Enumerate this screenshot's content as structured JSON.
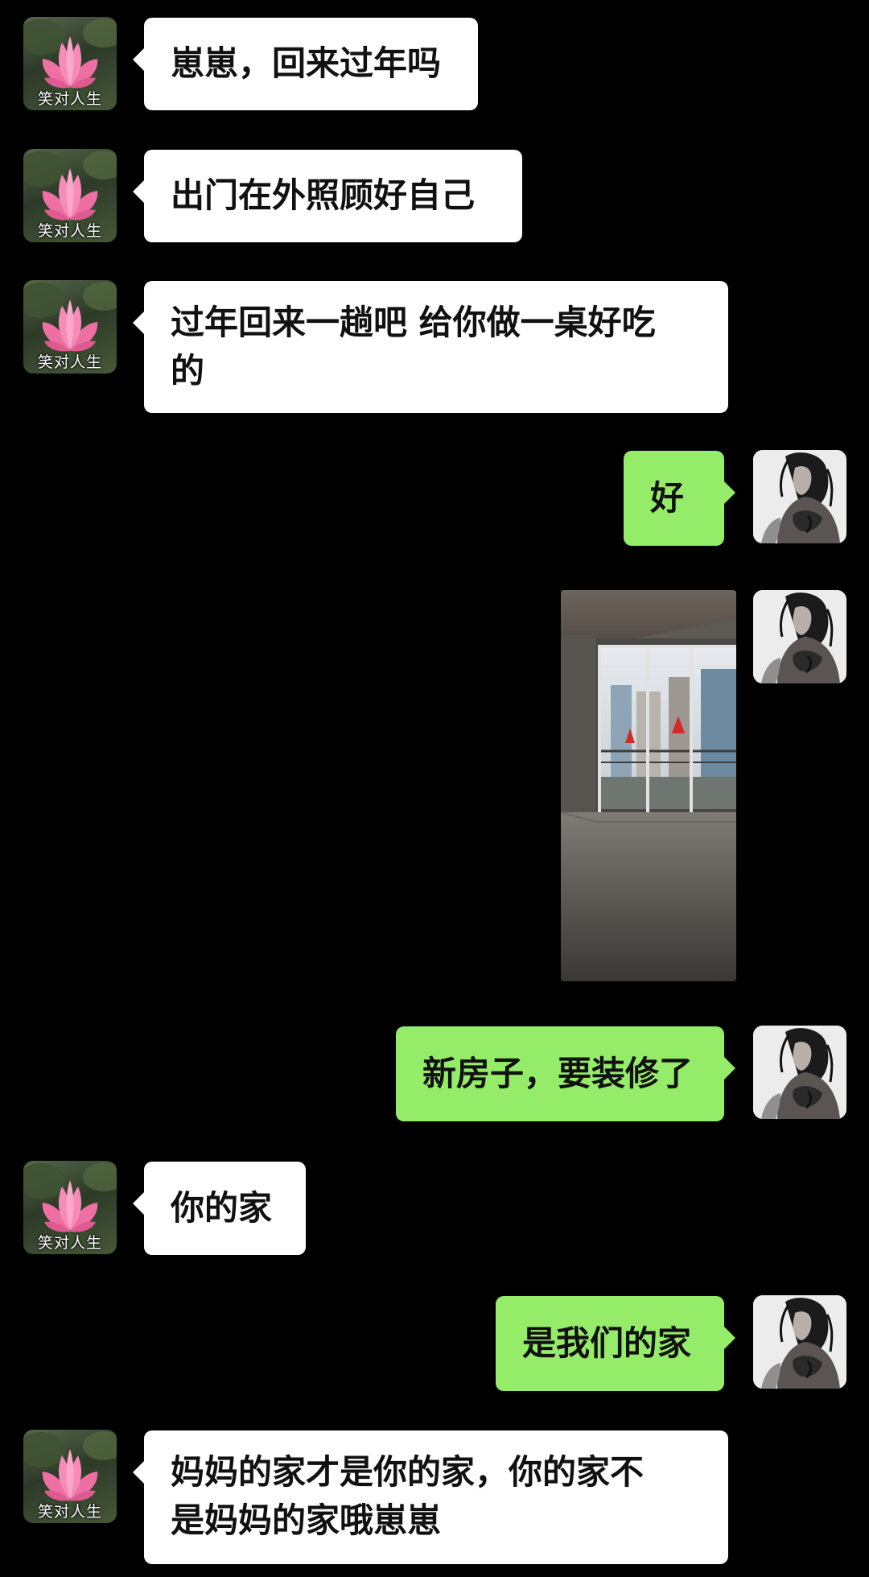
{
  "chat": {
    "contact_name": "笑对人生",
    "messages": [
      {
        "sender": "contact",
        "type": "text",
        "text": "崽崽，回来过年吗"
      },
      {
        "sender": "contact",
        "type": "text",
        "text": "出门在外照顾好自己"
      },
      {
        "sender": "contact",
        "type": "text",
        "text": "过年回来一趟吧 给你做一桌好吃\n的"
      },
      {
        "sender": "me",
        "type": "text",
        "text": "好"
      },
      {
        "sender": "me",
        "type": "image",
        "description": ""
      },
      {
        "sender": "me",
        "type": "text",
        "text": "新房子，要装修了"
      },
      {
        "sender": "contact",
        "type": "text",
        "text": "你的家"
      },
      {
        "sender": "me",
        "type": "text",
        "text": "是我们的家"
      },
      {
        "sender": "contact",
        "type": "text",
        "text": "妈妈的家才是你的家，你的家不\n是妈妈的家哦崽崽"
      }
    ]
  },
  "colors": {
    "background": "#000000",
    "incoming_bubble": "#ffffff",
    "outgoing_bubble": "#95ec69",
    "text": "#111111"
  },
  "icons": {
    "contact_avatar": "lotus-flower-avatar",
    "my_avatar": "sketch-figure-avatar"
  }
}
